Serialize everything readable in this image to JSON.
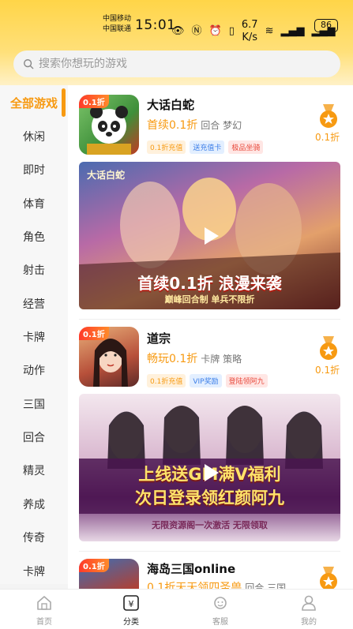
{
  "status_bar": {
    "carrier1": "中国移动",
    "carrier2": "中国联通",
    "time": "15:01",
    "net_speed_top": "6.7",
    "net_speed_bottom": "K/s",
    "battery": "86"
  },
  "search": {
    "placeholder": "搜索你想玩的游戏"
  },
  "sidebar": {
    "categories": [
      "全部游戏",
      "休闲",
      "即时",
      "体育",
      "角色",
      "射击",
      "经营",
      "卡牌",
      "动作",
      "三国",
      "回合",
      "精灵",
      "养成",
      "传奇",
      "卡牌"
    ],
    "active_index": 0
  },
  "games": [
    {
      "name": "大话白蛇",
      "tag_badge": "0.1折",
      "highlight": "首续0.1折",
      "genres": "回合 梦幻",
      "tags": [
        "0.1折充值",
        "送充值卡",
        "极品坐骑"
      ],
      "rebate": "0.1折",
      "banner_title": "首续0.1折 浪漫来袭",
      "banner_subtitle": "巅峰回合制 单兵不限折",
      "banner_logo": "大话白蛇"
    },
    {
      "name": "道宗",
      "tag_badge": "0.1折",
      "highlight": "畅玩0.1折",
      "genres": "卡牌 策略",
      "tags": [
        "0.1折充值",
        "VIP奖励",
        "登陆领阿九"
      ],
      "rebate": "0.1折",
      "banner_title": "上线送GM满V福利",
      "banner_line2": "次日登录领红颜阿九",
      "banner_subtitle": "无限资源阁一次激活  无限领取"
    },
    {
      "name": "海岛三国online",
      "tag_badge": "0.1折",
      "highlight": "0.1折天天领四圣兽",
      "genres": "回合 三国"
    }
  ],
  "nav": [
    {
      "label": "首页",
      "icon": "home-icon"
    },
    {
      "label": "分类",
      "icon": "category-icon"
    },
    {
      "label": "客服",
      "icon": "service-icon"
    },
    {
      "label": "我的",
      "icon": "profile-icon"
    }
  ],
  "colors": {
    "accent": "#f79a12",
    "header_yellow": "#ffd548"
  }
}
